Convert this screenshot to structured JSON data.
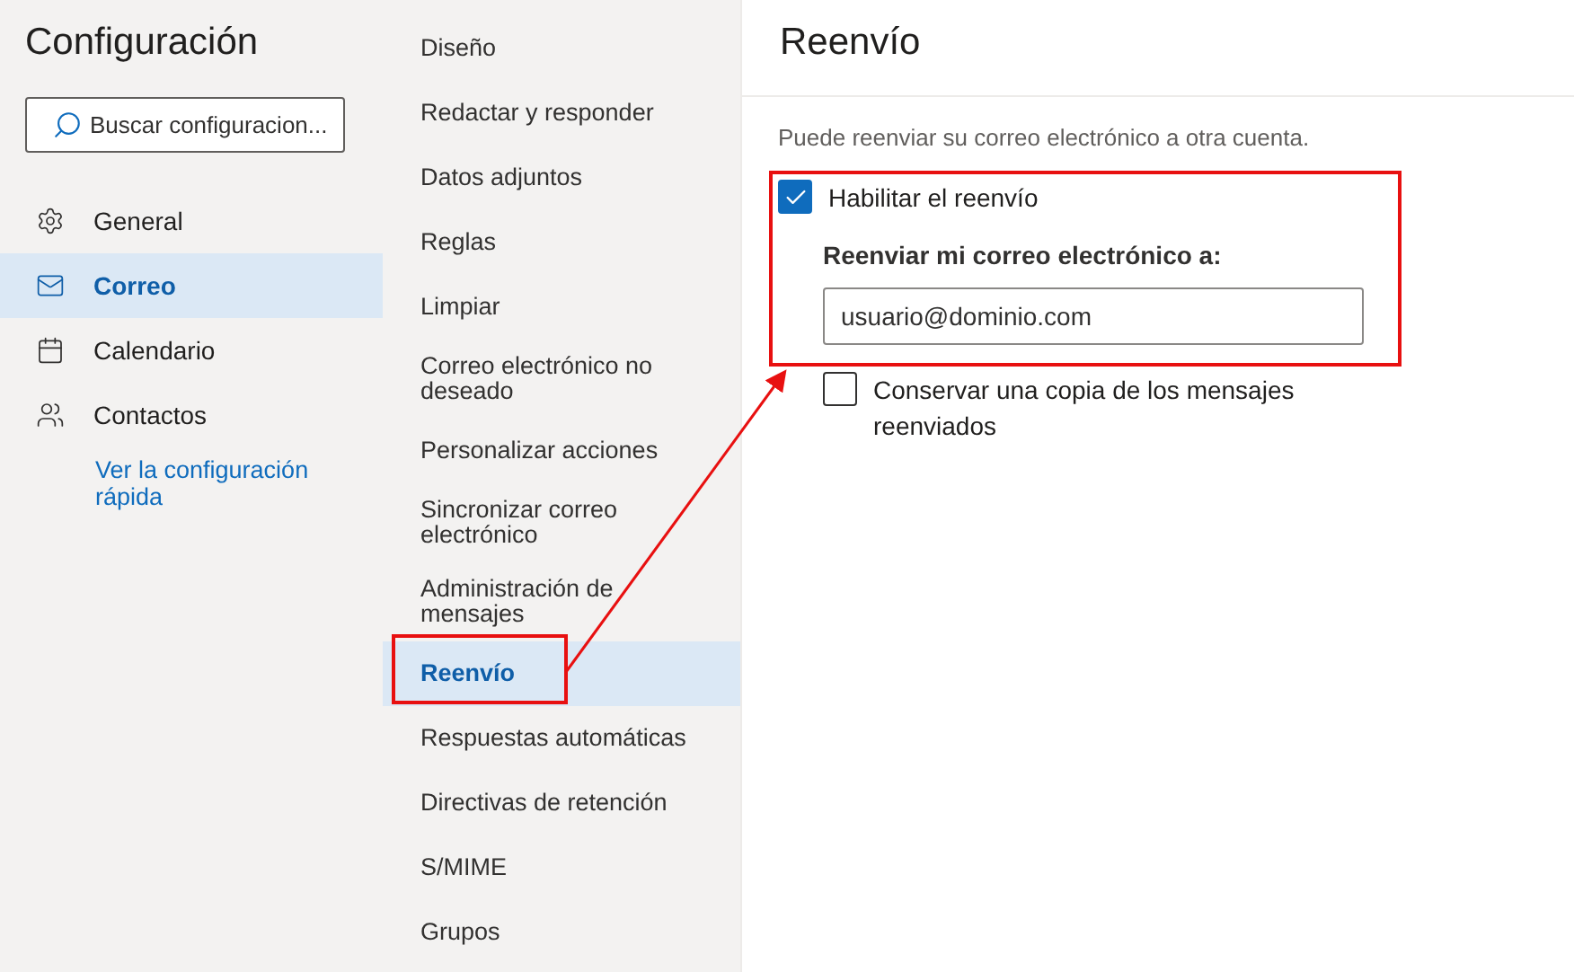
{
  "sidebar": {
    "title": "Configuración",
    "search": {
      "placeholder": "Buscar configuracion..."
    },
    "items": [
      {
        "label": "General",
        "kind": "gear",
        "selected": false
      },
      {
        "label": "Correo",
        "kind": "mail",
        "selected": true
      },
      {
        "label": "Calendario",
        "kind": "calendar",
        "selected": false
      },
      {
        "label": "Contactos",
        "kind": "people",
        "selected": false
      }
    ],
    "quick_link": "Ver la configuración rápida"
  },
  "categories": [
    {
      "label": "Diseño",
      "selected": false
    },
    {
      "label": "Redactar y responder",
      "selected": false
    },
    {
      "label": "Datos adjuntos",
      "selected": false
    },
    {
      "label": "Reglas",
      "selected": false
    },
    {
      "label": "Limpiar",
      "selected": false
    },
    {
      "label": "Correo electrónico no deseado",
      "selected": false
    },
    {
      "label": "Personalizar acciones",
      "selected": false
    },
    {
      "label": "Sincronizar correo electrónico",
      "selected": false
    },
    {
      "label": "Administración de mensajes",
      "selected": false
    },
    {
      "label": "Reenvío",
      "selected": true
    },
    {
      "label": "Respuestas automáticas",
      "selected": false
    },
    {
      "label": "Directivas de retención",
      "selected": false
    },
    {
      "label": "S/MIME",
      "selected": false
    },
    {
      "label": "Grupos",
      "selected": false
    }
  ],
  "content": {
    "title": "Reenvío",
    "description": "Puede reenviar su correo electrónico a otra cuenta.",
    "enable": {
      "label": "Habilitar el reenvío",
      "checked": true
    },
    "address_label": "Reenviar mi correo electrónico a:",
    "address_value": "usuario@dominio.com",
    "keep_copy": {
      "label": "Conservar una copia de los mensajes reenviados",
      "checked": false
    }
  }
}
